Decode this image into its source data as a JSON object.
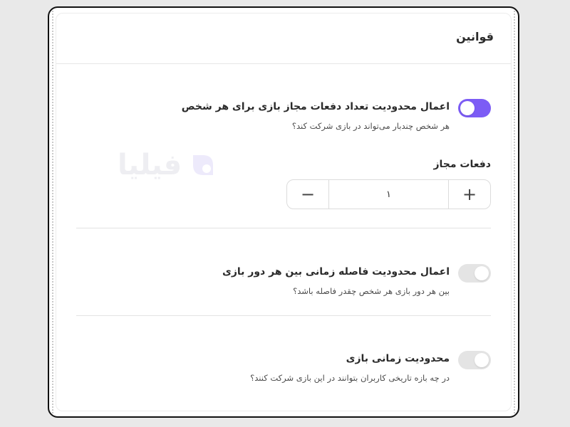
{
  "card": {
    "title": "قوانین"
  },
  "watermark": {
    "text": "فیلیا",
    "logo_icon": "filia-logo-icon"
  },
  "settings": [
    {
      "title": "اعمال محدودیت تعداد دفعات مجاز بازی برای هر شخص",
      "description": "هر شخص چندبار می‌تواند در بازی شرکت کند؟",
      "enabled": true
    },
    {
      "title": "اعمال محدودیت فاصله زمانی بین هر دور بازی",
      "description": "بین هر دور بازی هر شخص چقدر فاصله باشد؟",
      "enabled": false
    },
    {
      "title": "محدودیت زمانی بازی",
      "description": "در چه بازه تاریخی کاربران بتوانند در این بازی شرکت کنند؟",
      "enabled": false
    }
  ],
  "allowed_count": {
    "label": "دفعات مجاز",
    "value": "۱",
    "plus_symbol": "+",
    "minus_symbol": "−"
  },
  "colors": {
    "accent": "#7c5cf5",
    "toggle_off": "#e4e4e4"
  }
}
